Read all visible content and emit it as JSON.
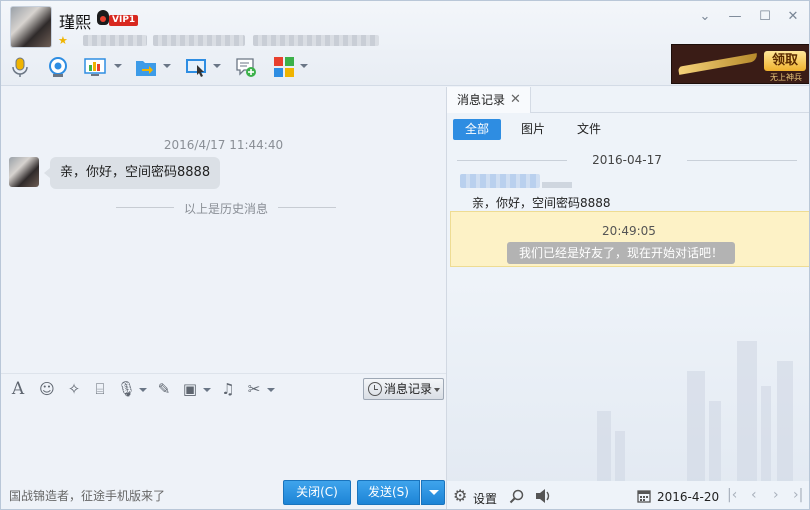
{
  "header": {
    "contact_name": "瑾熙",
    "vip_label": "VIP1",
    "window_controls": [
      "chevron-down",
      "minimize",
      "maximize",
      "close"
    ],
    "toolbar_icons": [
      "microphone-icon",
      "video-camera-icon",
      "screen-share-icon",
      "file-transfer-icon",
      "remote-desktop-icon",
      "add-chat-icon",
      "apps-icon"
    ],
    "ad": {
      "button": "领取",
      "subtitle": "无上神兵"
    }
  },
  "chat": {
    "timestamp": "2016/4/17 11:44:40",
    "message": "亲，你好，空间密码8888",
    "history_separator": "以上是历史消息",
    "input_toolbar_icons": [
      "font-icon",
      "emoji-icon",
      "magic-wand-icon",
      "screenshot-icon",
      "voice-icon",
      "edit-icon",
      "image-icon",
      "music-icon",
      "scissors-icon"
    ],
    "history_button": "消息记录",
    "promo_text": "国战锦造者，征途手机版来了",
    "close_button": "关闭(C)",
    "send_button": "发送(S)"
  },
  "history": {
    "tab_label": "消息记录",
    "filters": [
      "全部",
      "图片",
      "文件"
    ],
    "date": "2016-04-17",
    "message": "亲，你好，空间密码8888",
    "system_time": "20:49:05",
    "system_message": "我们已经是好友了，现在开始对话吧！",
    "settings_label": "设置",
    "calendar_date": "2016-4-20"
  },
  "colors": {
    "accent_blue": "#1d84d6",
    "system_bg": "#fdf2c6",
    "vip_red": "#d8281f"
  }
}
